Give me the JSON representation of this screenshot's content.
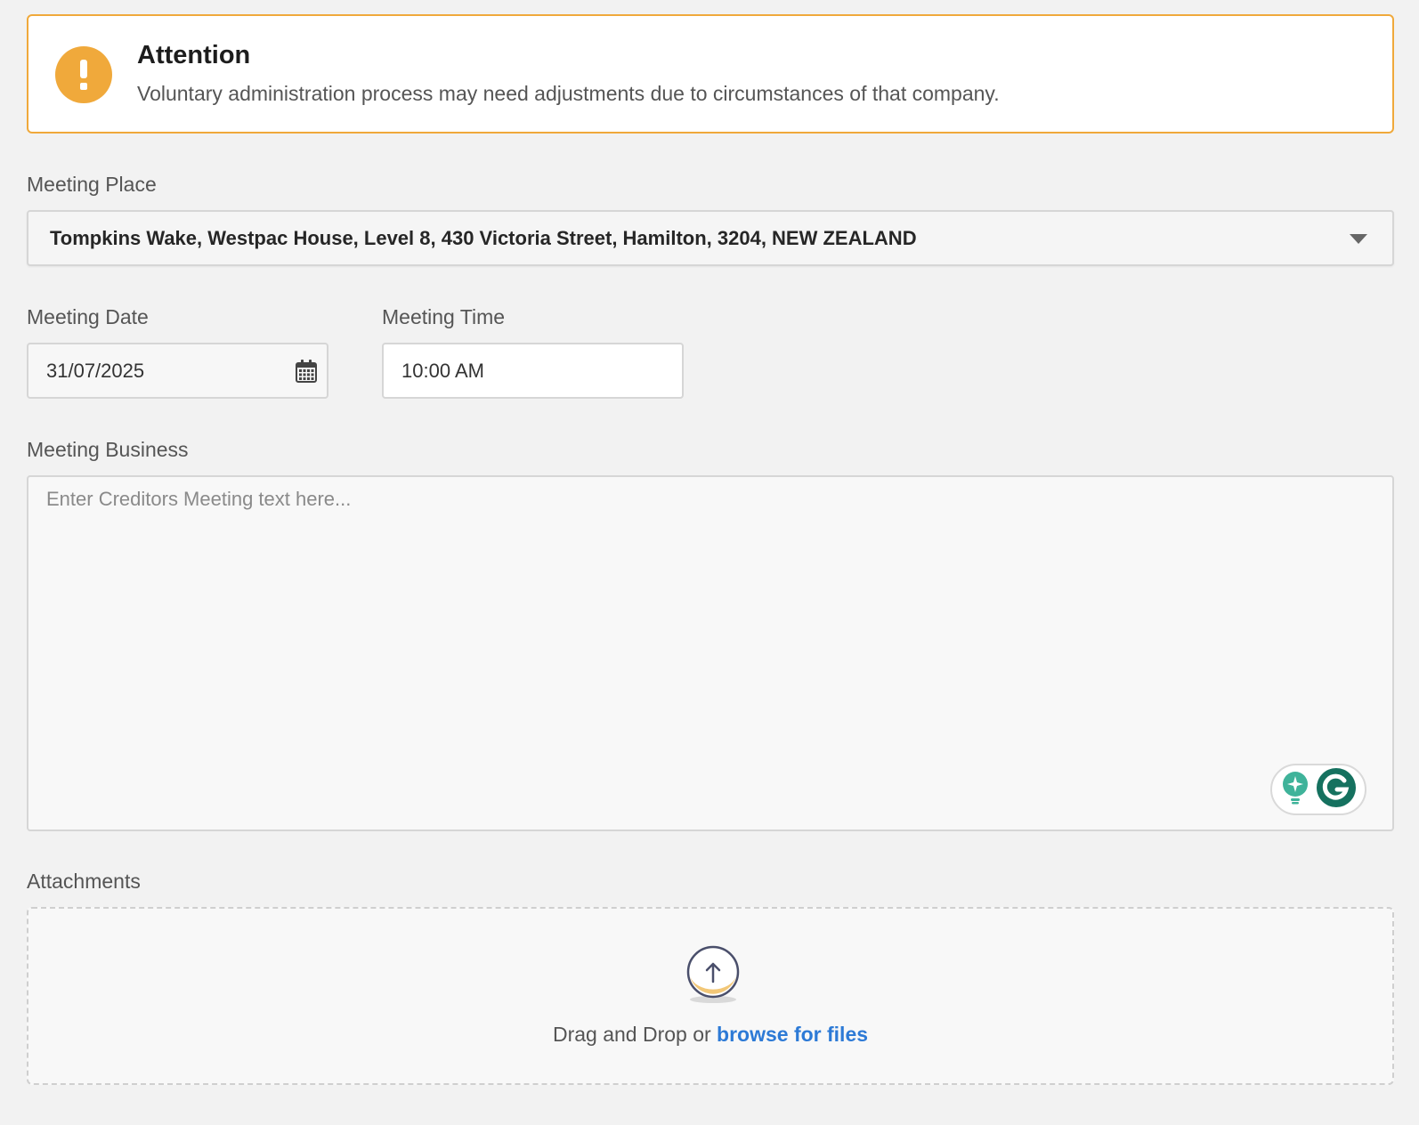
{
  "alert": {
    "title": "Attention",
    "message": "Voluntary administration process may need adjustments due to circumstances of that company.",
    "icon": "exclamation-icon",
    "color": "#f0a93b"
  },
  "meeting_place": {
    "label": "Meeting Place",
    "value": "Tompkins Wake, Westpac House, Level 8, 430 Victoria Street, Hamilton, 3204, NEW ZEALAND"
  },
  "meeting_date": {
    "label": "Meeting Date",
    "value": "31/07/2025",
    "icon": "calendar-icon"
  },
  "meeting_time": {
    "label": "Meeting Time",
    "value": "10:00 AM"
  },
  "meeting_business": {
    "label": "Meeting Business",
    "placeholder": "Enter Creditors Meeting text here..."
  },
  "attachments": {
    "label": "Attachments",
    "drag_text": "Drag and Drop or",
    "browse_text": "browse for files",
    "link_color": "#2d7ad6"
  }
}
